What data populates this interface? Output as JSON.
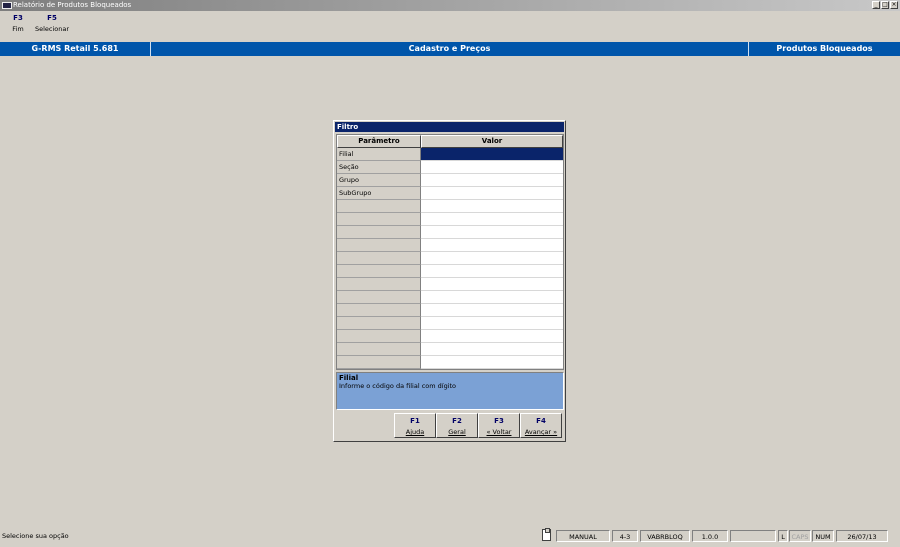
{
  "window": {
    "title": "Relatório de Produtos Bloqueados",
    "controls": [
      "_",
      "□",
      "×"
    ]
  },
  "fkeys": [
    {
      "key": "F3",
      "label": "Fim"
    },
    {
      "key": "F5",
      "label": "Selecionar"
    }
  ],
  "infobar": {
    "product": "G-RMS Retail 5.681",
    "module": "Cadastro e Preços",
    "screen": "Produtos Bloqueados"
  },
  "dialog": {
    "title": "Filtro",
    "columns": {
      "param": "Parâmetro",
      "value": "Valor"
    },
    "rows": [
      {
        "param": "Filial",
        "value": "",
        "selected": true
      },
      {
        "param": "Seção",
        "value": ""
      },
      {
        "param": "Grupo",
        "value": ""
      },
      {
        "param": "SubGrupo",
        "value": ""
      },
      {
        "param": "",
        "value": ""
      },
      {
        "param": "",
        "value": ""
      },
      {
        "param": "",
        "value": ""
      },
      {
        "param": "",
        "value": ""
      },
      {
        "param": "",
        "value": ""
      },
      {
        "param": "",
        "value": ""
      },
      {
        "param": "",
        "value": ""
      },
      {
        "param": "",
        "value": ""
      },
      {
        "param": "",
        "value": ""
      },
      {
        "param": "",
        "value": ""
      },
      {
        "param": "",
        "value": ""
      },
      {
        "param": "",
        "value": ""
      },
      {
        "param": "",
        "value": ""
      }
    ],
    "help": {
      "title": "Filial",
      "text": "Informe o código da filial com dígito"
    },
    "buttons": [
      {
        "key": "F1",
        "label": "Ajuda"
      },
      {
        "key": "F2",
        "label": "Geral"
      },
      {
        "key": "F3",
        "label": "« Voltar"
      },
      {
        "key": "F4",
        "label": "Avançar »"
      }
    ]
  },
  "statusbar": {
    "message": "Selecione sua opção",
    "mode": "MANUAL",
    "code": "4-3",
    "program": "VABRBLOQ",
    "version": "1.0.0",
    "blank": "",
    "l": "L",
    "caps": "CAPS",
    "num": "NUM",
    "date": "26/07/13"
  }
}
